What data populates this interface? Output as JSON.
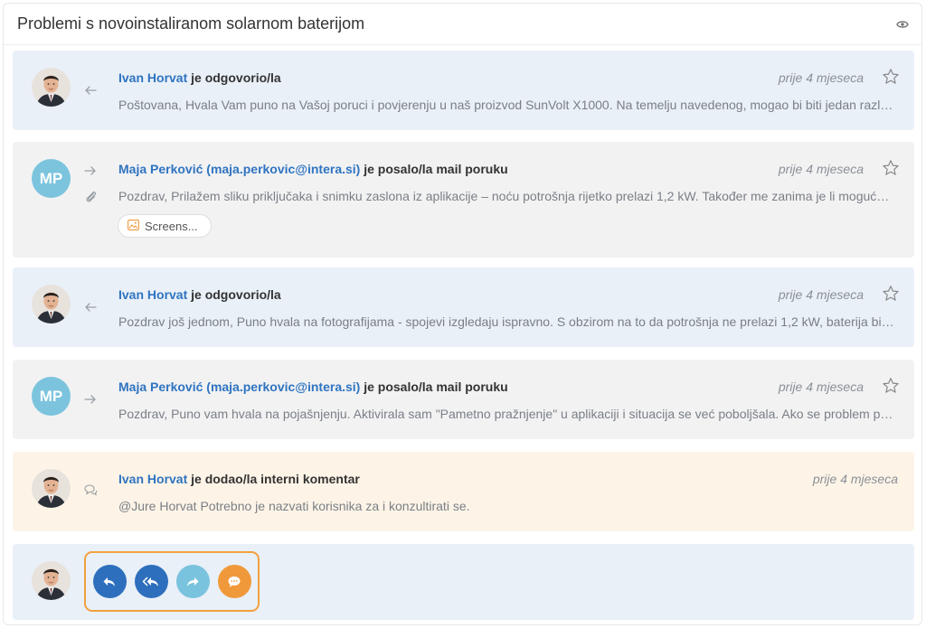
{
  "ticket": {
    "title": "Problemi s novoinstaliranom solarnom baterijom"
  },
  "messages": [
    {
      "kind": "reply",
      "author": "Ivan Horvat",
      "action": " je odgovorio/la",
      "time": "prije 4 mjeseca",
      "preview": "Poštovana, Hvala Vam puno na Vašoj poruci i povjerenju u naš proizvod SunVolt X1000. Na temelju navedenog, mogao bi biti jedan razlog zbog kojeg baterija ne radi kako očekujete."
    },
    {
      "kind": "sent",
      "initials": "MP",
      "author": "Maja Perković (maja.perkovic@intera.si)",
      "action": " je posalo/la mail poruku",
      "time": "prije 4 mjeseca",
      "preview": "Pozdrav, Prilažem sliku priključaka i snimku zaslona iz aplikacije – noću potrošnja rijetko prelazi 1,2 kW. Također me zanima je li moguće podesiti postavke.",
      "attachment": "Screens..."
    },
    {
      "kind": "reply",
      "author": "Ivan Horvat",
      "action": " je odgovorio/la",
      "time": "prije 4 mjeseca",
      "preview": "Pozdrav još jednom, Puno hvala na fotografijama - spojevi izgledaju ispravno. S obzirom na to da potrošnja ne prelazi 1,2 kW, baterija bi trebala raditi optimalno."
    },
    {
      "kind": "sent",
      "initials": "MP",
      "author": "Maja Perković (maja.perkovic@intera.si)",
      "action": " je posalo/la mail poruku",
      "time": "prije 4 mjeseca",
      "preview": "Pozdrav, Puno vam hvala na pojašnjenju. Aktivirala sam \"Pametno pražnjenje\" u aplikaciji i situacija se već poboljšala. Ako se problem ponovi, javit ću se."
    },
    {
      "kind": "note",
      "author": "Ivan Horvat",
      "action": " je dodao/la interni komentar",
      "time": "prije 4 mjeseca",
      "preview": "@Jure Horvat  Potrebno je nazvati korisnika za i konzultirati se."
    }
  ],
  "icons": {
    "eye": "eye-icon",
    "star": "star-icon",
    "reply": "reply-arrow-icon",
    "forward": "forward-arrow-icon",
    "paperclip": "paperclip-icon",
    "comment": "comment-bubbles-icon",
    "image": "image-icon"
  },
  "composer": {
    "actions": [
      "reply",
      "reply-all",
      "forward",
      "internal-comment"
    ]
  },
  "colors": {
    "link": "#2f74c0",
    "reply_bg": "#e9f0f8",
    "sent_bg": "#f2f2f3",
    "note_bg": "#fdf4e7",
    "highlight": "#f2a13e",
    "action_blue": "#2e6fbd",
    "action_light": "#7ac3de",
    "action_orange": "#f0993b"
  }
}
